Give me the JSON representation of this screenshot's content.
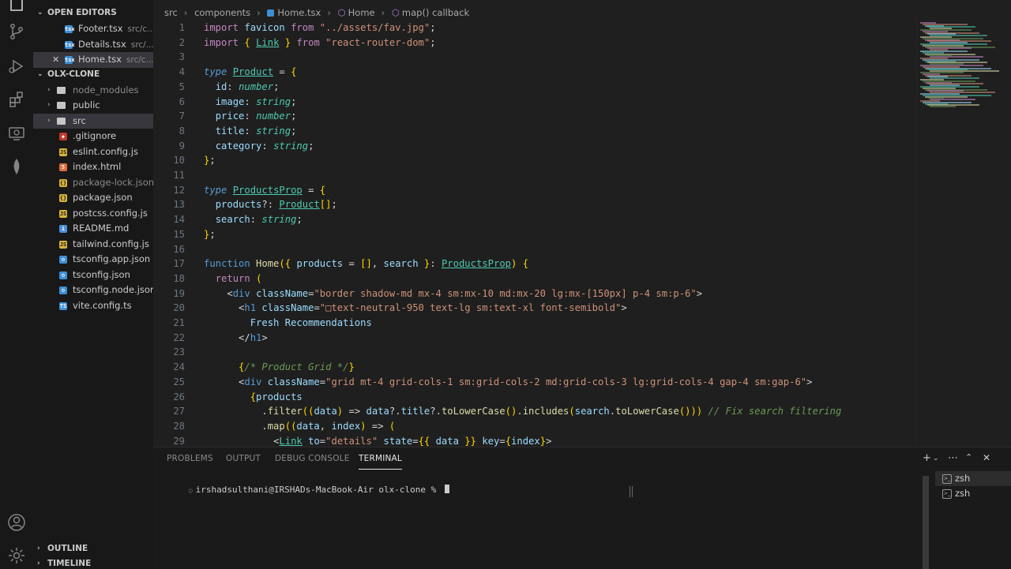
{
  "explorer": {
    "open_editors_title": "OPEN EDITORS",
    "open_editors": [
      {
        "name": "Footer.tsx",
        "desc": "src/c..."
      },
      {
        "name": "Details.tsx",
        "desc": "src/..."
      },
      {
        "name": "Home.tsx",
        "desc": "src/c..."
      }
    ],
    "project_title": "OLX-CLONE",
    "files": [
      {
        "name": "node_modules",
        "icon": "folder"
      },
      {
        "name": "public",
        "icon": "folder"
      },
      {
        "name": "src",
        "icon": "folder"
      },
      {
        "name": ".gitignore",
        "icon": "git"
      },
      {
        "name": "eslint.config.js",
        "icon": "js"
      },
      {
        "name": "index.html",
        "icon": "html"
      },
      {
        "name": "package-lock.json",
        "icon": "json"
      },
      {
        "name": "package.json",
        "icon": "json"
      },
      {
        "name": "postcss.config.js",
        "icon": "js"
      },
      {
        "name": "README.md",
        "icon": "md"
      },
      {
        "name": "tailwind.config.js",
        "icon": "js"
      },
      {
        "name": "tsconfig.app.json",
        "icon": "ts-json"
      },
      {
        "name": "tsconfig.json",
        "icon": "ts-json"
      },
      {
        "name": "tsconfig.node.json",
        "icon": "ts-json"
      },
      {
        "name": "vite.config.ts",
        "icon": "ts"
      }
    ],
    "outline_title": "OUTLINE",
    "timeline_title": "TIMELINE"
  },
  "breadcrumb": [
    "src",
    "components",
    "Home.tsx",
    "Home",
    "map() callback"
  ],
  "code_lines": [
    {
      "n": "1",
      "text": "import favicon from \"../assets/fav.jpg\";"
    },
    {
      "n": "2",
      "text": "import { Link } from \"react-router-dom\";"
    },
    {
      "n": "3",
      "text": ""
    },
    {
      "n": "4",
      "text": "type Product = {"
    },
    {
      "n": "5",
      "text": "  id: number;"
    },
    {
      "n": "6",
      "text": "  image: string;"
    },
    {
      "n": "7",
      "text": "  price: number;"
    },
    {
      "n": "8",
      "text": "  title: string;"
    },
    {
      "n": "9",
      "text": "  category: string;"
    },
    {
      "n": "10",
      "text": "};"
    },
    {
      "n": "11",
      "text": ""
    },
    {
      "n": "12",
      "text": "type ProductsProp = {"
    },
    {
      "n": "13",
      "text": "  products?: Product[];"
    },
    {
      "n": "14",
      "text": "  search: string;"
    },
    {
      "n": "15",
      "text": "};"
    },
    {
      "n": "16",
      "text": ""
    },
    {
      "n": "17",
      "text": "function Home({ products = [], search }: ProductsProp) {"
    },
    {
      "n": "18",
      "text": "  return ("
    },
    {
      "n": "19",
      "text": "    <div className=\"border shadow-md mx-4 sm:mx-10 md:mx-20 lg:mx-[150px] p-4 sm:p-6\">"
    },
    {
      "n": "20",
      "text": "      <h1 className=\"□text-neutral-950 text-lg sm:text-xl font-semibold\">"
    },
    {
      "n": "21",
      "text": "        Fresh Recommendations"
    },
    {
      "n": "22",
      "text": "      </h1>"
    },
    {
      "n": "23",
      "text": ""
    },
    {
      "n": "24",
      "text": "      {/* Product Grid */}"
    },
    {
      "n": "25",
      "text": "      <div className=\"grid mt-4 grid-cols-1 sm:grid-cols-2 md:grid-cols-3 lg:grid-cols-4 gap-4 sm:gap-6\">"
    },
    {
      "n": "26",
      "text": "        {products"
    },
    {
      "n": "27",
      "text": "          .filter((data) => data?.title?.toLowerCase().includes(search.toLowerCase())) // Fix search filtering"
    },
    {
      "n": "28",
      "text": "          .map((data, index) => ("
    },
    {
      "n": "29",
      "text": "            <Link to=\"details\" state={{ data }} key={index}>"
    }
  ],
  "panel": {
    "tabs": [
      "PROBLEMS",
      "OUTPUT",
      "DEBUG CONSOLE",
      "TERMINAL"
    ],
    "prompt": "irshadsulthani@IRSHADs-MacBook-Air olx-clone % ",
    "terminals": [
      "zsh",
      "zsh"
    ]
  },
  "colors": {
    "keyword": "#c586c0",
    "string": "#ce9178",
    "type": "#4ec9b0",
    "function": "#dcdcaa",
    "variable": "#9cdcfe",
    "comment": "#6a9955",
    "bracket": "#ffd700"
  }
}
